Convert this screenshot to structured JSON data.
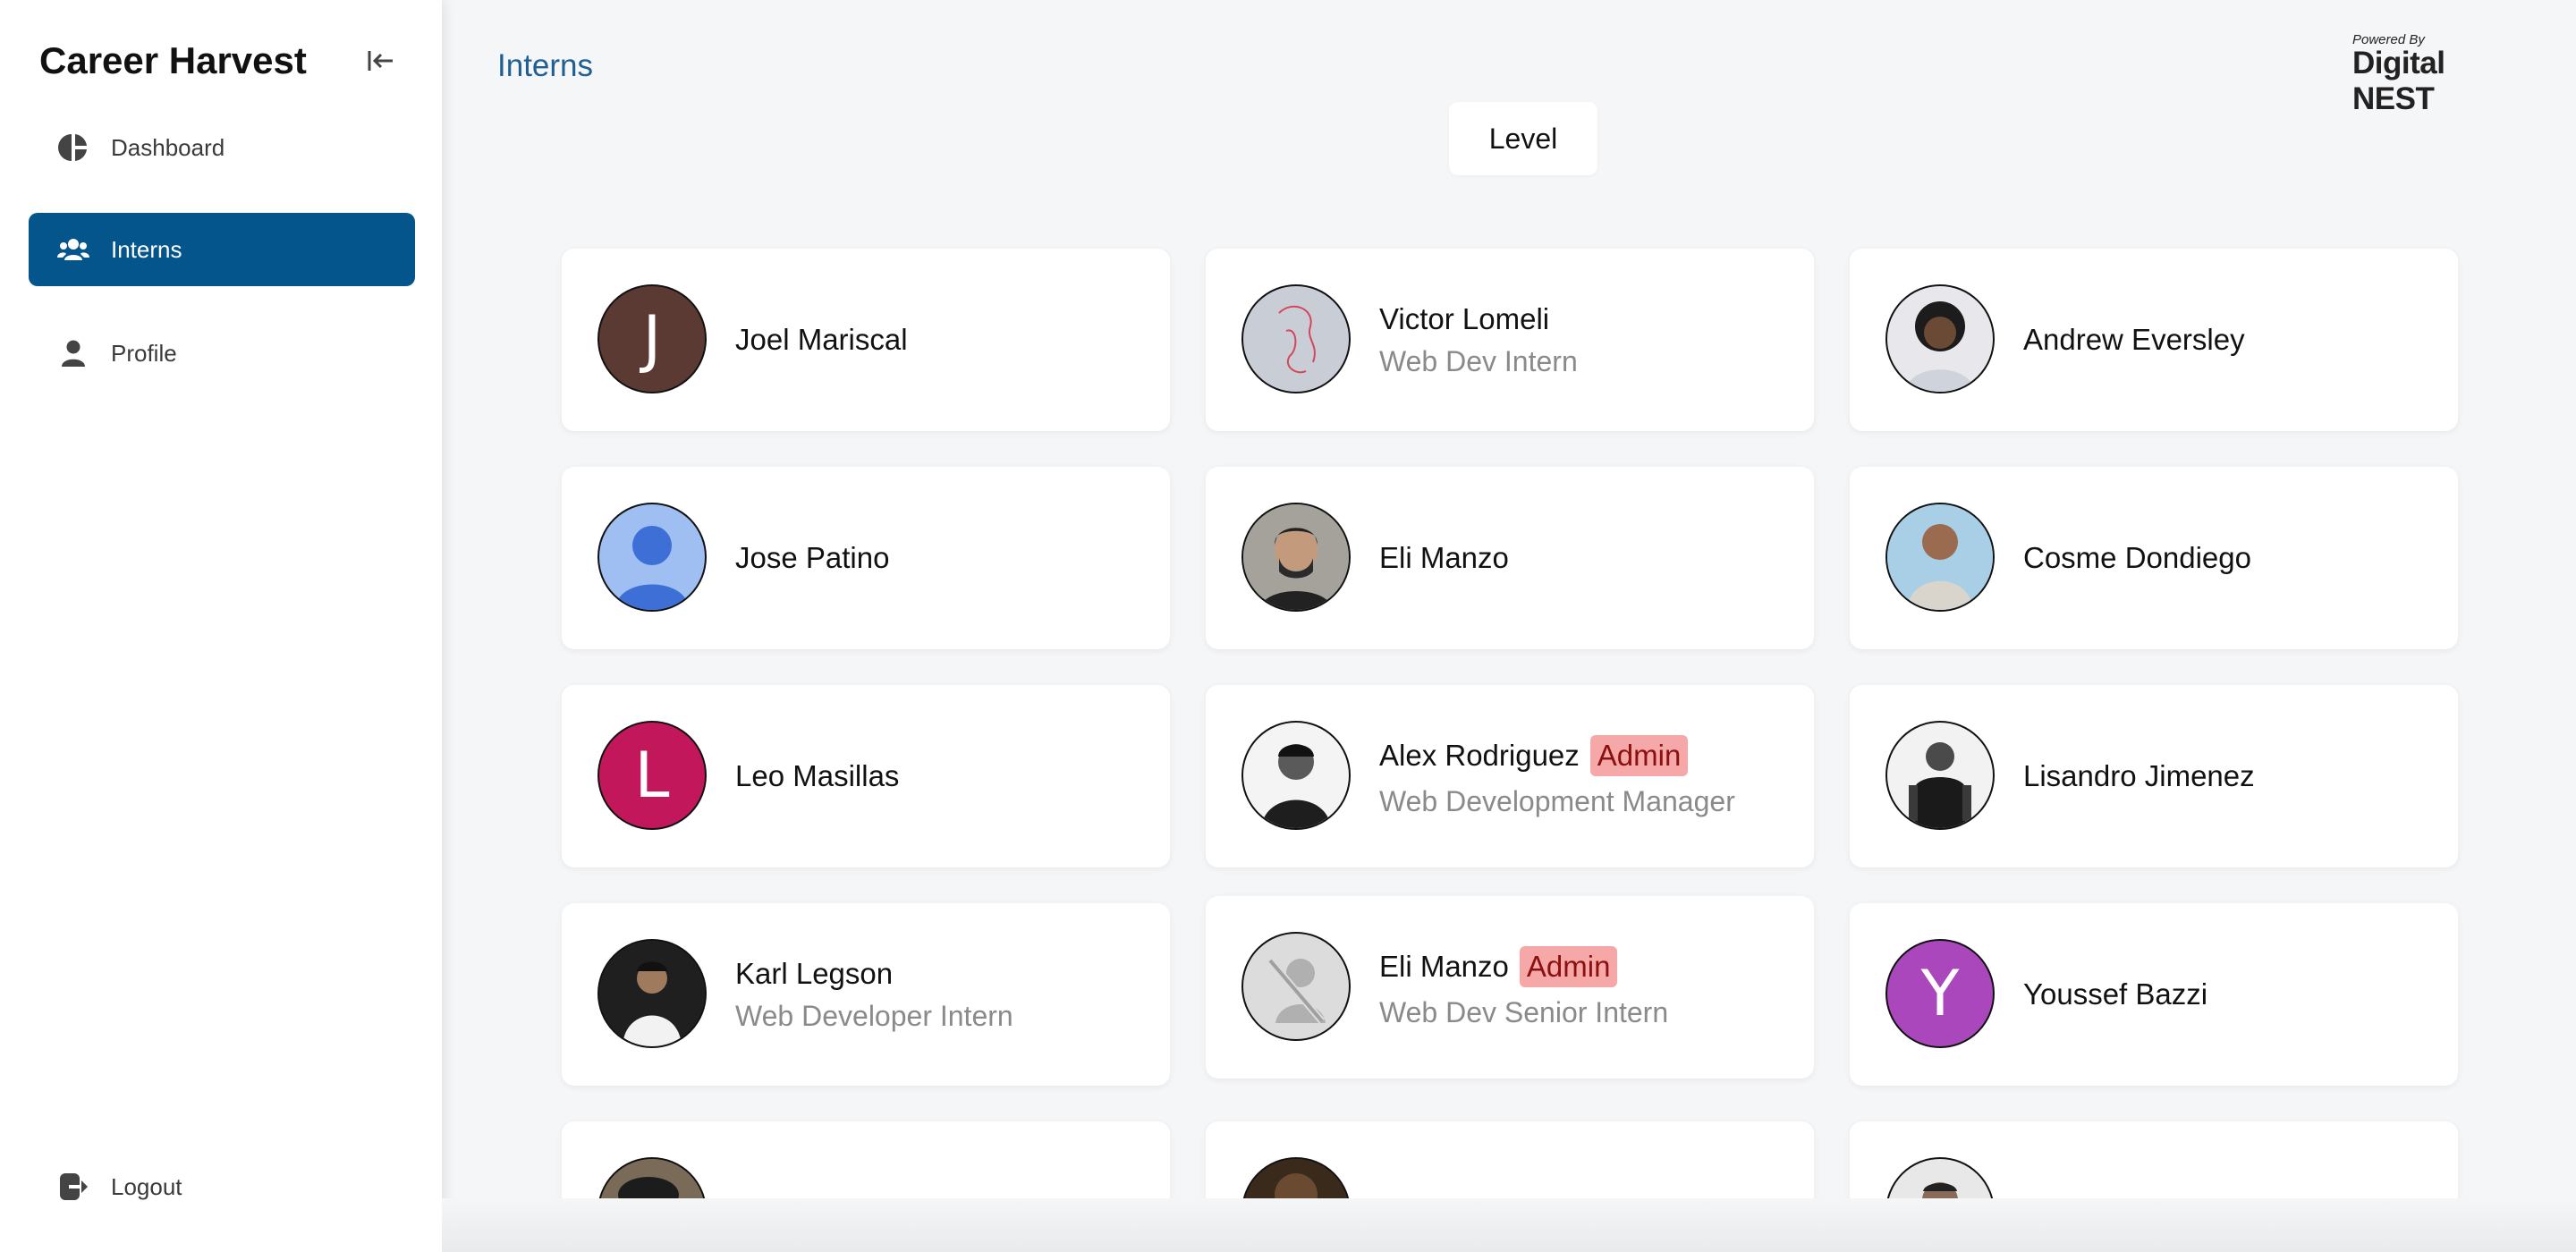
{
  "app": {
    "title": "Career Harvest"
  },
  "sidebar": {
    "items": [
      {
        "label": "Dashboard",
        "icon": "dashboard-icon",
        "active": false
      },
      {
        "label": "Interns",
        "icon": "users-icon",
        "active": true
      },
      {
        "label": "Profile",
        "icon": "user-icon",
        "active": false
      }
    ],
    "logout_label": "Logout"
  },
  "header": {
    "breadcrumb": "Interns",
    "powered_small": "Powered By",
    "powered_brand": "Digital NEST"
  },
  "filter": {
    "level_label": "Level"
  },
  "colors": {
    "accent": "#03558c",
    "admin_badge": "#f6a8a8"
  },
  "interns": [
    {
      "name": "Joel Mariscal",
      "role": "",
      "admin": false,
      "avatar_letter": "J",
      "avatar_color": "#5b3a33"
    },
    {
      "name": "Victor Lomeli",
      "role": "Web Dev Intern",
      "admin": false,
      "avatar_letter": "",
      "avatar_color": "#c9ced6"
    },
    {
      "name": "Andrew Eversley",
      "role": "",
      "admin": false,
      "avatar_letter": "",
      "avatar_color": "#3c3c44"
    },
    {
      "name": "Jose Patino",
      "role": "",
      "admin": false,
      "avatar_letter": "",
      "avatar_color": "#9fbff3"
    },
    {
      "name": "Eli Manzo",
      "role": "",
      "admin": false,
      "avatar_letter": "",
      "avatar_color": "#6a6c6e"
    },
    {
      "name": "Cosme Dondiego",
      "role": "",
      "admin": false,
      "avatar_letter": "",
      "avatar_color": "#8ab8d8"
    },
    {
      "name": "Leo Masillas",
      "role": "",
      "admin": false,
      "avatar_letter": "L",
      "avatar_color": "#c2185b"
    },
    {
      "name": "Alex Rodriguez",
      "role": "Web Development Manager",
      "admin": true,
      "avatar_letter": "",
      "avatar_color": "#e8e8e8"
    },
    {
      "name": "Lisandro Jimenez",
      "role": "",
      "admin": false,
      "avatar_letter": "",
      "avatar_color": "#f2f2f2"
    },
    {
      "name": "Karl Legson",
      "role": "Web Developer Intern",
      "admin": false,
      "avatar_letter": "",
      "avatar_color": "#2a2a2a"
    },
    {
      "name": "Eli Manzo",
      "role": "Web Dev Senior Intern",
      "admin": true,
      "avatar_letter": "",
      "avatar_color": "#dcdcdc"
    },
    {
      "name": "Youssef Bazzi",
      "role": "",
      "admin": false,
      "avatar_letter": "Y",
      "avatar_color": "#ab47bc"
    },
    {
      "name": "",
      "role": "",
      "admin": false,
      "avatar_letter": "",
      "avatar_color": "#5a4a3a"
    },
    {
      "name": "",
      "role": "",
      "admin": false,
      "avatar_letter": "",
      "avatar_color": "#4a3a2a"
    },
    {
      "name": "",
      "role": "",
      "admin": false,
      "avatar_letter": "",
      "avatar_color": "#e8e8e8"
    }
  ],
  "admin_badge_label": "Admin"
}
